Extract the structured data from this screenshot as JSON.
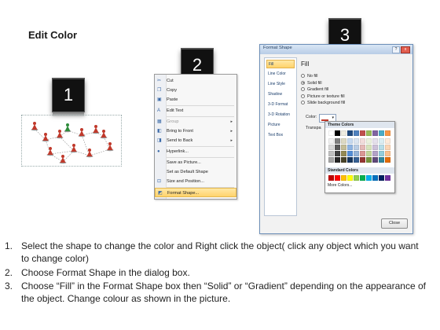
{
  "page_title": "Edit Color",
  "steps": [
    "1",
    "2",
    "3"
  ],
  "context_menu": {
    "items": [
      {
        "label": "Cut",
        "icon": "scissors-icon",
        "disabled": false,
        "submenu": false,
        "selected": false
      },
      {
        "label": "Copy",
        "icon": "copy-icon",
        "disabled": false,
        "submenu": false,
        "selected": false
      },
      {
        "label": "Paste",
        "icon": "paste-icon",
        "disabled": false,
        "submenu": false,
        "selected": false
      },
      {
        "label": "Edit Text",
        "icon": "edit-text-icon",
        "disabled": false,
        "submenu": false,
        "selected": false
      },
      {
        "label": "Group",
        "icon": "group-icon",
        "disabled": true,
        "submenu": true,
        "selected": false
      },
      {
        "label": "Bring to Front",
        "icon": "bring-front-icon",
        "disabled": false,
        "submenu": true,
        "selected": false
      },
      {
        "label": "Send to Back",
        "icon": "send-back-icon",
        "disabled": false,
        "submenu": true,
        "selected": false
      },
      {
        "label": "Hyperlink...",
        "icon": "hyperlink-icon",
        "disabled": false,
        "submenu": false,
        "selected": false
      },
      {
        "label": "Save as Picture...",
        "icon": "",
        "disabled": false,
        "submenu": false,
        "selected": false
      },
      {
        "label": "Set as Default Shape",
        "icon": "",
        "disabled": false,
        "submenu": false,
        "selected": false
      },
      {
        "label": "Size and Position...",
        "icon": "size-icon",
        "disabled": false,
        "submenu": false,
        "selected": false
      },
      {
        "label": "Format Shape...",
        "icon": "format-shape-icon",
        "disabled": false,
        "submenu": false,
        "selected": true
      }
    ]
  },
  "dialog": {
    "title": "Format Shape",
    "help_label": "?",
    "close_x": "x",
    "nav": [
      "Fill",
      "Line Color",
      "Line Style",
      "Shadow",
      "3-D Format",
      "3-D Rotation",
      "Picture",
      "Text Box"
    ],
    "selected_nav": "Fill",
    "pane_title": "Fill",
    "options": [
      {
        "label": "No fill",
        "type": "radio",
        "checked": false
      },
      {
        "label": "Solid fill",
        "type": "radio",
        "checked": true
      },
      {
        "label": "Gradient fill",
        "type": "radio",
        "checked": false
      },
      {
        "label": "Picture or texture fill",
        "type": "radio",
        "checked": false
      },
      {
        "label": "Slide background fill",
        "type": "radio",
        "checked": false
      }
    ],
    "color_label": "Color:",
    "transparency_label": "Transpa",
    "theme_colors_label": "Theme Colors",
    "standard_colors_label": "Standard Colors",
    "more_colors_label": "More Colors...",
    "close_button": "Close",
    "theme_colors": [
      [
        "#ffffff",
        "#000000",
        "#eeece1",
        "#1f497d",
        "#4f81bd",
        "#c0504d",
        "#9bbb59",
        "#8064a2",
        "#4bacc6",
        "#f79646"
      ],
      [
        "#f2f2f2",
        "#7f7f7f",
        "#ddd9c3",
        "#c6d9f0",
        "#dbe5f1",
        "#f2dcdb",
        "#ebf1dd",
        "#e5e0ec",
        "#dbeef3",
        "#fdeada"
      ],
      [
        "#d8d8d8",
        "#595959",
        "#c4bd97",
        "#8db3e2",
        "#b8cce4",
        "#e5b9b7",
        "#d7e3bc",
        "#ccc1d9",
        "#b7dde8",
        "#fbd5b5"
      ],
      [
        "#bfbfbf",
        "#3f3f3f",
        "#938953",
        "#548dd4",
        "#95b3d7",
        "#d99694",
        "#c3d69b",
        "#b2a2c7",
        "#92cddc",
        "#fac08f"
      ],
      [
        "#a5a5a5",
        "#262626",
        "#494429",
        "#17365d",
        "#366092",
        "#953734",
        "#76923c",
        "#5f497a",
        "#31859b",
        "#e36c09"
      ]
    ],
    "standard_colors": [
      "#c00000",
      "#ff0000",
      "#ffc000",
      "#ffff00",
      "#92d050",
      "#00b050",
      "#00b0f0",
      "#0070c0",
      "#002060",
      "#7030a0"
    ]
  },
  "instructions": [
    {
      "n": "1.",
      "text": "Select the shape to change the color and Right click the object( click any object which you want to change color)"
    },
    {
      "n": "2.",
      "text": "Choose Format Shape in the dialog box."
    },
    {
      "n": "3.",
      "text": "Choose “Fill” in the Format Shape box then “Solid” or “Gradient” depending on the appearance of the object. Change colour as shown in the picture."
    }
  ],
  "colors": {
    "cone_red": "#c0392b",
    "cone_green": "#2e8b3a",
    "menu_highlight": "#ffd36b"
  }
}
